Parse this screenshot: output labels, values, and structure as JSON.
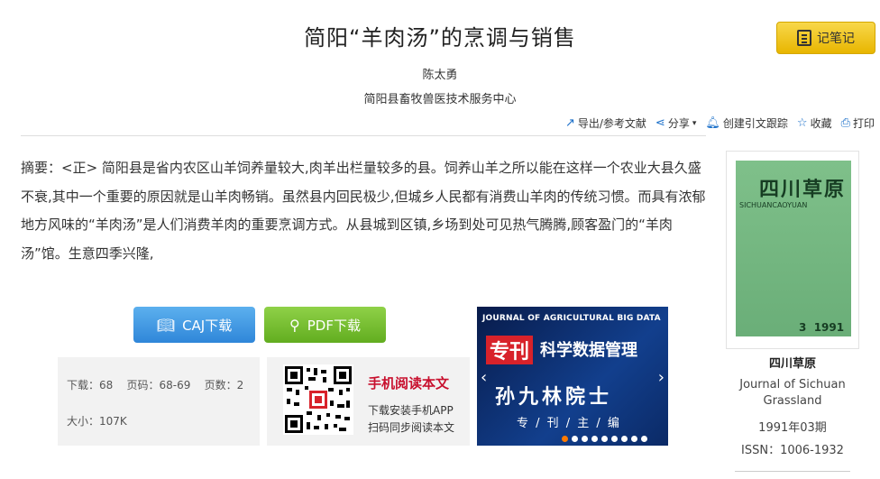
{
  "article": {
    "title": "简阳“羊肉汤”的烹调与销售",
    "author": "陈太勇",
    "organization": "简阳县畜牧兽医技术服务中心",
    "note_button": "记笔记"
  },
  "tools": {
    "export": "导出/参考文献",
    "share": "分享",
    "citation": "创建引文跟踪",
    "favorite": "收藏",
    "print": "打印"
  },
  "abstract": {
    "label": "摘要：",
    "text": "<正> 简阳县是省内农区山羊饲养量较大,肉羊出栏量较多的县。饲养山羊之所以能在这样一个农业大县久盛不衰,其中一个重要的原因就是山羊肉畅销。虽然县内回民极少,但城乡人民都有消费山羊肉的传统习惯。而具有浓郁地方风味的“羊肉汤”是人们消费羊肉的重要烹调方式。从县城到区镇,乡场到处可见热气腾腾,顾客盈门的“羊肉汤”馆。生意四季兴隆,"
  },
  "downloads": {
    "caj": "CAJ下载",
    "pdf": "PDF下载"
  },
  "stats": {
    "line1": "下载：68    页码：68-69    页数：2",
    "line2": "大小：107K"
  },
  "mobile": {
    "title": "手机阅读本文",
    "line1": "下载安装手机APP",
    "line2": "扫码同步阅读本文"
  },
  "banner": {
    "line1": "JOURNAL OF AGRICULTURAL BIG DATA",
    "tag": "专刊",
    "topic": "科学数据管理",
    "name": "孙九林院士",
    "role": "专 / 刊 / 主 / 编",
    "slides": 9,
    "active_slide": 1
  },
  "journal": {
    "cover_title": "四川草原",
    "cover_sub": "SICHUANCAOYUAN",
    "cover_issue": "3  1991",
    "name": "四川草原",
    "name_en": "Journal of Sichuan Grassland",
    "date": "1991年03期",
    "issn": "ISSN：1006-1932"
  },
  "colors": {
    "note_button": "#e8b600",
    "caj_button": "#2f86d9",
    "pdf_button": "#62ad20",
    "mobile_title": "#c8102e",
    "cover": "#7fc08a"
  }
}
